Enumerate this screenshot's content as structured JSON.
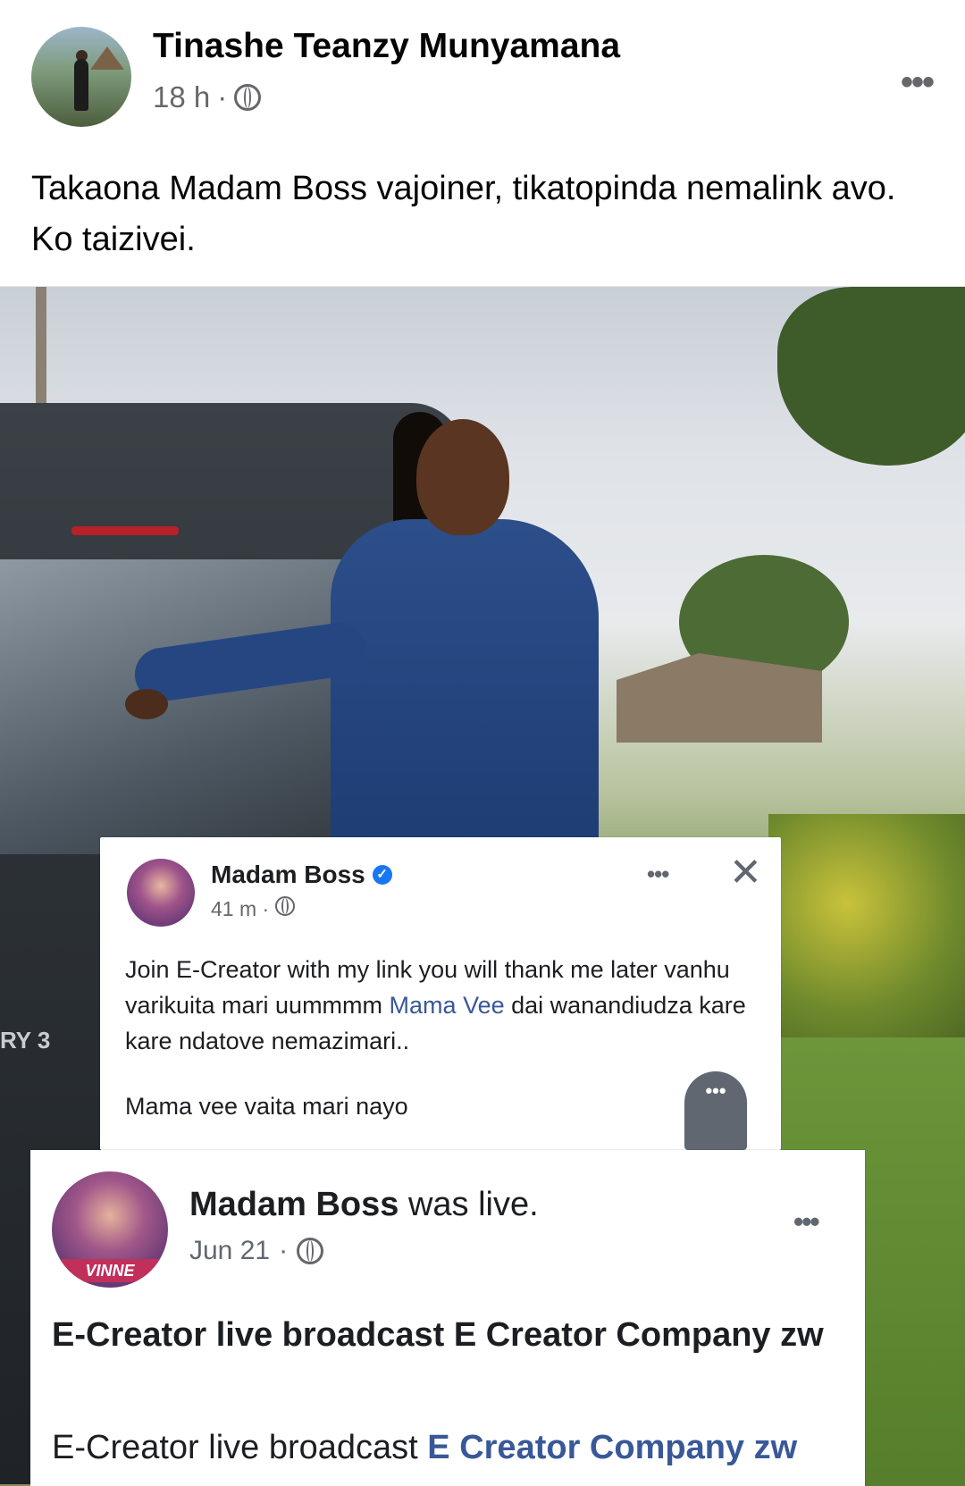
{
  "post": {
    "author": "Tinashe Teanzy Munyamana",
    "time": "18 h",
    "separator": "·",
    "more_icon": "more-horizontal-icon",
    "audience_icon": "globe-icon",
    "text": "Takaona Madam Boss vajoiner, tikatopinda nemalink avo. Ko taizivei."
  },
  "screenshot1": {
    "name": "Madam Boss",
    "verified_icon": "verified-badge-icon",
    "time": "41 m",
    "separator": "·",
    "text_before_tag": "Join E-Creator with my link you will thank me later vanhu varikuita mari uummmm ",
    "tag": "Mama Vee",
    "text_after_tag": " dai wanandiudza kare kare ndatove nemazimari..",
    "text2": "Mama vee vaita mari nayo",
    "more_label": "•••",
    "close_label": "✕",
    "bubble_label": "•••"
  },
  "screenshot2": {
    "name": "Madam Boss",
    "suffix": " was live.",
    "date": "Jun 21",
    "separator": "·",
    "more_label": "•••",
    "avatar_caption": "VINNE",
    "headline": "E-Creator live broadcast E Creator Company zw",
    "desc_before": "E-Creator live broadcast ",
    "desc_tag": "E Creator Company zw"
  },
  "photo": {
    "vehicle_badge": "RY 3"
  },
  "colors": {
    "link": "#385898",
    "verified": "#1877f2",
    "meta": "#65676b"
  }
}
